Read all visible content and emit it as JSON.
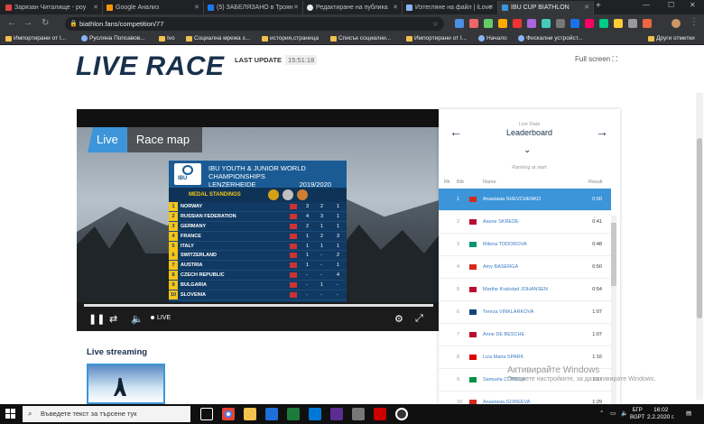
{
  "browser": {
    "tabs": [
      {
        "title": "Зарязан Читалище - роу",
        "color": "#d44"
      },
      {
        "title": "Google Анализ",
        "color": "#f29900"
      },
      {
        "title": "(5) ЗАБЕЛЯЗАНО в Троян",
        "color": "#1877f2"
      },
      {
        "title": "Редактиране на публика",
        "color": "#e8eaed"
      },
      {
        "title": "Изтегляне на файл | iLove",
        "color": "#8ab4f8"
      },
      {
        "title": "IBU CUP BIATHLON",
        "color": "#3c95d8"
      }
    ],
    "new_tab": "+",
    "window_controls": {
      "minimize": "—",
      "maximize": "☐",
      "close": "✕"
    },
    "url": "biathlon.fans/competition/77",
    "bookmarks": [
      "Импортирани от I...",
      "Русляна Попсавов...",
      "Ivo",
      "Социална мрежа з...",
      "история,страница",
      "Списък социални...",
      "Импортирани от I...",
      "Начало",
      "Фискални устройст...",
      "Други отметки"
    ]
  },
  "page": {
    "title": "LIVE RACE",
    "last_update_label": "LAST UPDATE",
    "last_update_time": "15:51:18",
    "fullscreen_label": "Full screen",
    "video": {
      "tab_live": "Live",
      "tab_map": "Race map",
      "live_label": "LIVE",
      "board": {
        "title_line1": "IBU YOUTH & JUNIOR WORLD CHAMPIONSHIPS",
        "title_line2": "LENZERHEIDE",
        "year": "2019/2020",
        "logo": "IBU",
        "subtitle": "MEDAL STANDINGS",
        "rows": [
          {
            "rank": "1",
            "country": "NORWAY",
            "g": "3",
            "s": "2",
            "b": "1"
          },
          {
            "rank": "2",
            "country": "RUSSIAN FEDERATION",
            "g": "4",
            "s": "3",
            "b": "1"
          },
          {
            "rank": "3",
            "country": "GERMANY",
            "g": "2",
            "s": "1",
            "b": "1"
          },
          {
            "rank": "4",
            "country": "FRANCE",
            "g": "1",
            "s": "2",
            "b": "3"
          },
          {
            "rank": "5",
            "country": "ITALY",
            "g": "1",
            "s": "1",
            "b": "1"
          },
          {
            "rank": "6",
            "country": "SWITZERLAND",
            "g": "1",
            "s": "-",
            "b": "2"
          },
          {
            "rank": "7",
            "country": "AUSTRIA",
            "g": "1",
            "s": "-",
            "b": "1"
          },
          {
            "rank": "8",
            "country": "CZECH REPUBLIC",
            "g": "-",
            "s": "-",
            "b": "4"
          },
          {
            "rank": "9",
            "country": "BULGARIA",
            "g": "-",
            "s": "1",
            "b": "-"
          },
          {
            "rank": "10",
            "country": "SLOVENIA",
            "g": "-",
            "s": "-",
            "b": "-"
          }
        ]
      }
    },
    "leaderboard": {
      "small_label": "Live Data",
      "title": "Leaderboard",
      "ranking_label": "Ranking at start",
      "col_rk": "Rk",
      "col_bib": "Bib",
      "col_name": "Name",
      "col_result": "Result",
      "rows": [
        {
          "rank": "1",
          "name": "Anastasia SHEVCHENKO",
          "result": "0:00",
          "flag": "#d52b1e"
        },
        {
          "rank": "2",
          "name": "Aasne SKREDE",
          "result": "0:41",
          "flag": "#ba0c2f"
        },
        {
          "rank": "3",
          "name": "Milena TODOROVA",
          "result": "0:48",
          "flag": "#00966e"
        },
        {
          "rank": "4",
          "name": "Amy BASERGA",
          "result": "0:50",
          "flag": "#d52b1e"
        },
        {
          "rank": "5",
          "name": "Marthe Krakstad JOHANSEN",
          "result": "0:54",
          "flag": "#ba0c2f"
        },
        {
          "rank": "6",
          "name": "Tereza VINKLARKOVA",
          "result": "1:07",
          "flag": "#11457e"
        },
        {
          "rank": "7",
          "name": "Anne DE BESCHE",
          "result": "1:07",
          "flag": "#ba0c2f"
        },
        {
          "rank": "8",
          "name": "Liza Maria SPARK",
          "result": "1:16",
          "flag": "#dd0000"
        },
        {
          "rank": "9",
          "name": "Samuela COMOLA",
          "result": "1:17",
          "flag": "#009246"
        },
        {
          "rank": "10",
          "name": "Anastasia GOREEVA",
          "result": "1:29",
          "flag": "#d52b1e"
        }
      ]
    },
    "streaming_title": "Live streaming",
    "watermark_line1": "Активирайте Windows",
    "watermark_line2": "Отворете настройките, за да активирате Windows."
  },
  "taskbar": {
    "search_placeholder": "Въведете текст за търсене тук",
    "lang_top": "БГР",
    "lang_bottom": "BGPT",
    "time": "16:02",
    "date": "2.2.2020 г."
  }
}
